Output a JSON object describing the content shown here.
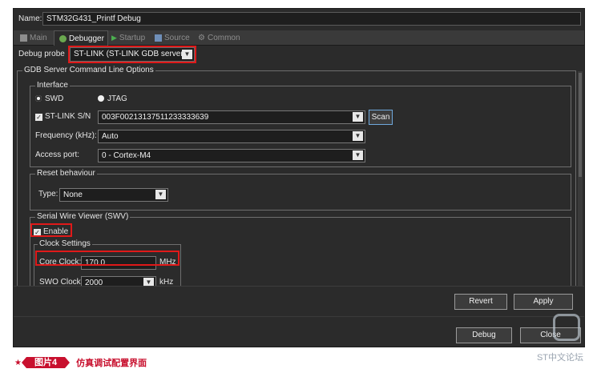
{
  "dialog": {
    "name_label": "Name:",
    "name_value": "STM32G431_Printf Debug"
  },
  "tabs": [
    {
      "label": "Main",
      "icon": "page-icon"
    },
    {
      "label": "Debugger",
      "icon": "bug-icon"
    },
    {
      "label": "Startup",
      "icon": "play-icon"
    },
    {
      "label": "Source",
      "icon": "source-icon"
    },
    {
      "label": "Common",
      "icon": "common-icon"
    }
  ],
  "probe": {
    "label": "Debug probe",
    "value": "ST-LINK (ST-LINK GDB server)"
  },
  "gdb_group": {
    "title": "GDB Server Command Line Options"
  },
  "interface": {
    "title": "Interface",
    "swd_label": "SWD",
    "jtag_label": "JTAG",
    "stlink_sn_label": "ST-LINK S/N",
    "stlink_sn_value": "003F00213137511233333639",
    "scan_label": "Scan",
    "frequency_label": "Frequency (kHz):",
    "frequency_value": "Auto",
    "access_port_label": "Access port:",
    "access_port_value": "0 - Cortex-M4"
  },
  "reset": {
    "title": "Reset behaviour",
    "type_label": "Type:",
    "type_value": "None"
  },
  "swv": {
    "title": "Serial Wire Viewer (SWV)",
    "enable_label": "Enable",
    "clock_title": "Clock Settings",
    "core_clock_label": "Core Clock:",
    "core_clock_value": "170.0",
    "core_clock_unit": "MHz",
    "swo_clock_label": "SWO Clock:",
    "swo_clock_value": "2000",
    "swo_clock_unit": "kHz"
  },
  "buttons": {
    "revert": "Revert",
    "apply": "Apply",
    "debug": "Debug",
    "close": "Close"
  },
  "caption": {
    "tag": "图片4",
    "text": "仿真调试配置界面"
  },
  "watermark": "ST中文论坛",
  "colors": {
    "highlight": "#e01919",
    "caption_red": "#c8102e",
    "dialog_bg": "#2b2b2b"
  }
}
